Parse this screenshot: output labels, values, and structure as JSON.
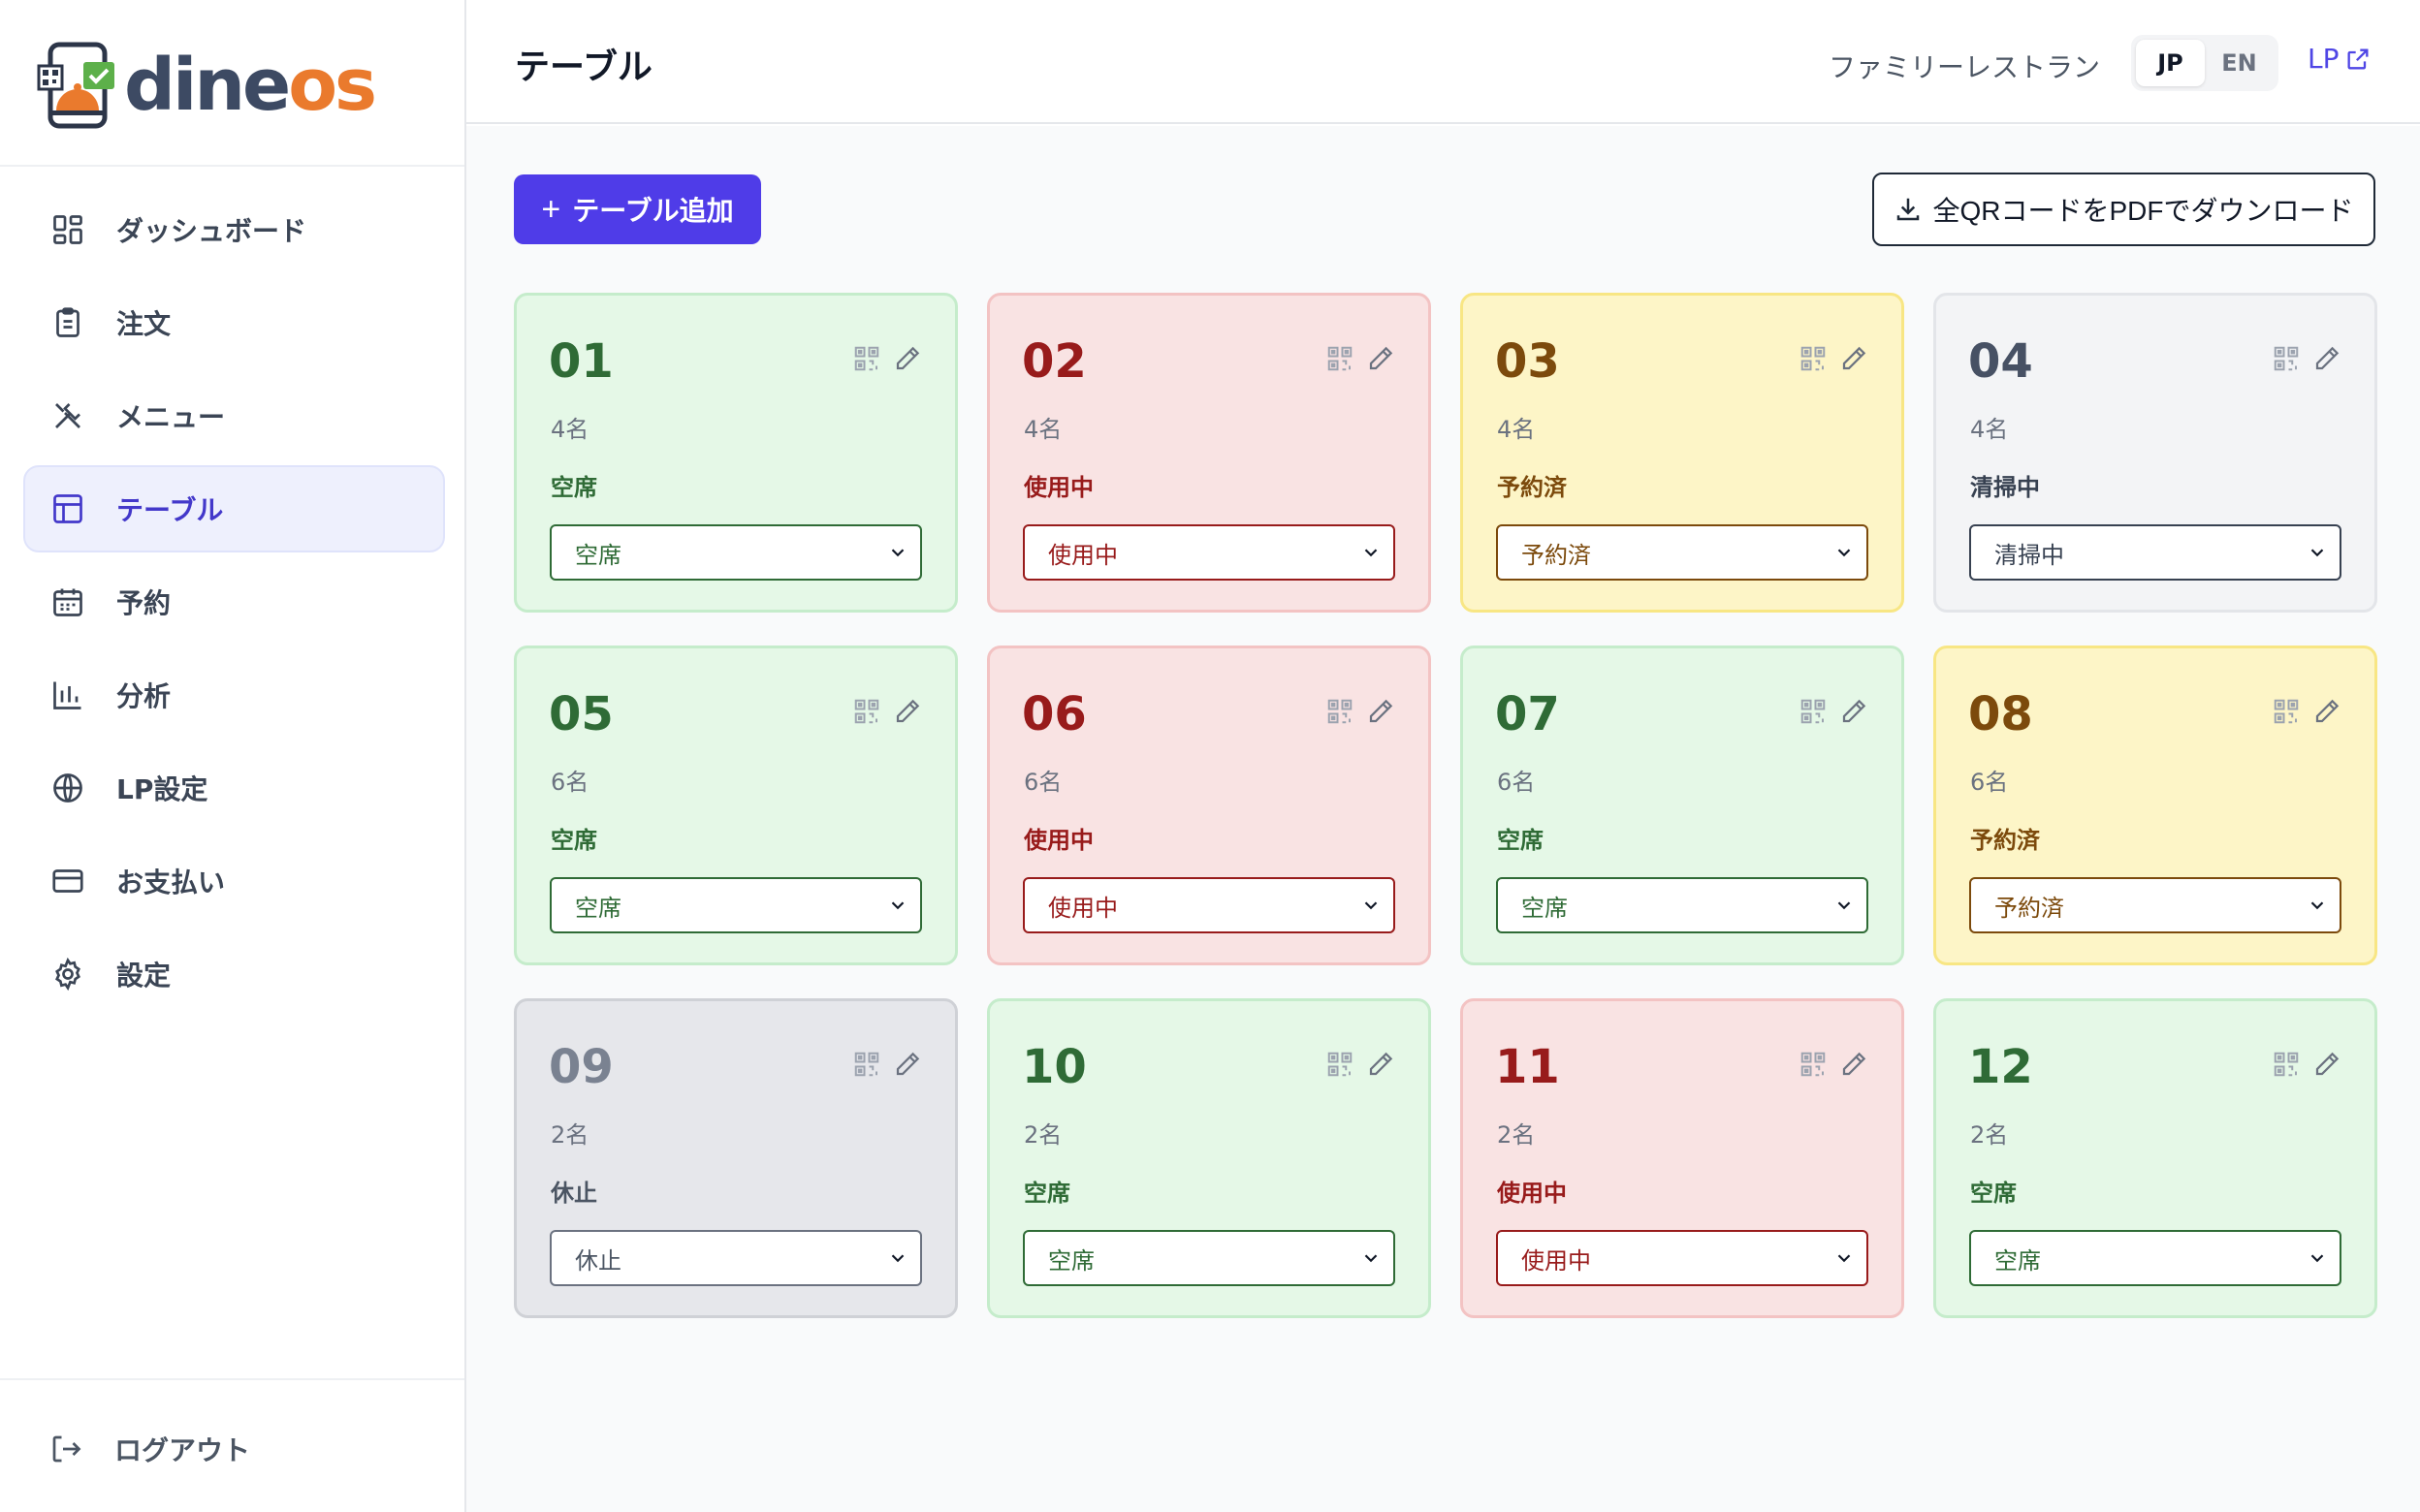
{
  "brand": {
    "name_part1": "dine",
    "name_part2": "os",
    "accent": "#ea7a2d"
  },
  "sidebar": {
    "items": [
      {
        "label": "ダッシュボード",
        "icon": "dashboard-icon"
      },
      {
        "label": "注文",
        "icon": "clipboard-icon"
      },
      {
        "label": "メニュー",
        "icon": "utensils-icon"
      },
      {
        "label": "テーブル",
        "icon": "table-icon",
        "active": true
      },
      {
        "label": "予約",
        "icon": "calendar-icon"
      },
      {
        "label": "分析",
        "icon": "bar-chart-icon"
      },
      {
        "label": "LP設定",
        "icon": "globe-icon"
      },
      {
        "label": "お支払い",
        "icon": "credit-card-icon"
      },
      {
        "label": "設定",
        "icon": "gear-icon"
      }
    ],
    "logout": "ログアウト"
  },
  "header": {
    "title": "テーブル",
    "restaurant": "ファミリーレストラン",
    "lang": {
      "jp": "JP",
      "en": "EN",
      "active": "JP"
    },
    "lp_link": "LP"
  },
  "toolbar": {
    "add_label": "テーブル追加",
    "download_label": "全QRコードをPDFでダウンロード"
  },
  "tables": [
    {
      "number": "01",
      "capacity": "4名",
      "status": "空席",
      "tone": "green"
    },
    {
      "number": "02",
      "capacity": "4名",
      "status": "使用中",
      "tone": "red"
    },
    {
      "number": "03",
      "capacity": "4名",
      "status": "予約済",
      "tone": "yellow"
    },
    {
      "number": "04",
      "capacity": "4名",
      "status": "清掃中",
      "tone": "gray"
    },
    {
      "number": "05",
      "capacity": "6名",
      "status": "空席",
      "tone": "green"
    },
    {
      "number": "06",
      "capacity": "6名",
      "status": "使用中",
      "tone": "red"
    },
    {
      "number": "07",
      "capacity": "6名",
      "status": "空席",
      "tone": "green"
    },
    {
      "number": "08",
      "capacity": "6名",
      "status": "予約済",
      "tone": "yellow"
    },
    {
      "number": "09",
      "capacity": "2名",
      "status": "休止",
      "tone": "dgray"
    },
    {
      "number": "10",
      "capacity": "2名",
      "status": "空席",
      "tone": "green"
    },
    {
      "number": "11",
      "capacity": "2名",
      "status": "使用中",
      "tone": "red"
    },
    {
      "number": "12",
      "capacity": "2名",
      "status": "空席",
      "tone": "green"
    }
  ],
  "colors": {
    "primary": "#4f3ce8",
    "available": "#2f6b36",
    "occupied": "#981b1b",
    "reserved": "#7c4a0c",
    "cleaning": "#374151",
    "inactive": "#6b7280"
  }
}
